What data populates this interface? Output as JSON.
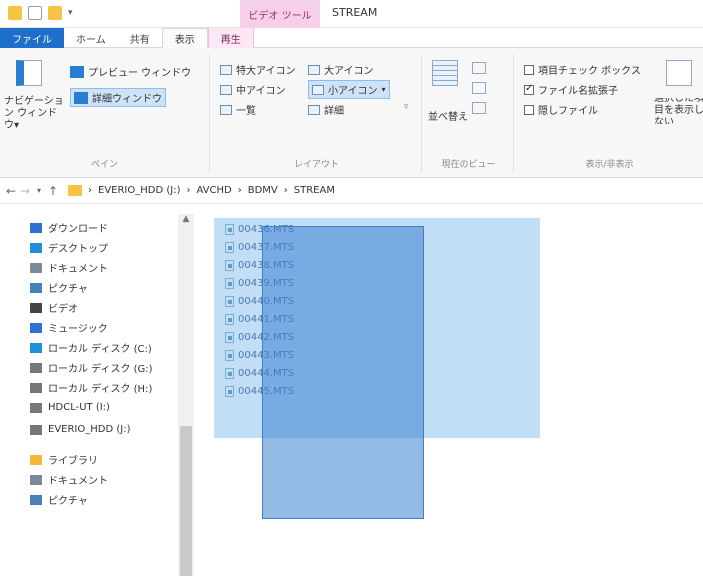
{
  "title_bar": {
    "context_tab_label": "ビデオ ツール",
    "window_title": "STREAM"
  },
  "tabs": [
    {
      "label": "ファイル"
    },
    {
      "label": "ホーム"
    },
    {
      "label": "共有"
    },
    {
      "label": "表示"
    },
    {
      "label": "再生"
    }
  ],
  "ribbon": {
    "pane": {
      "nav_pane_label": "ナビゲーション ウィンドウ▾",
      "preview_pane": "プレビュー ウィンドウ",
      "details_pane": "詳細ウィンドウ",
      "group_label": "ペイン"
    },
    "layout": {
      "extra_large": "特大アイコン",
      "large": "大アイコン",
      "medium": "中アイコン",
      "small": "小アイコン",
      "list": "一覧",
      "details": "詳細",
      "group_label": "レイアウト"
    },
    "current_view": {
      "sort_by": "並べ替え",
      "group_label": "現在のビュー"
    },
    "show_hide": {
      "item_checkboxes": "項目チェック ボックス",
      "item_checkboxes_checked": false,
      "file_extensions": "ファイル名拡張子",
      "file_extensions_checked": true,
      "hidden_items": "隠しファイル",
      "hidden_items_checked": false,
      "hide_selected": "選択した項目を表示しない",
      "group_label": "表示/非表示"
    }
  },
  "address": {
    "crumbs": [
      "EVERIO_HDD (J:)",
      "AVCHD",
      "BDMV",
      "STREAM"
    ]
  },
  "nav_items": [
    {
      "label": "ダウンロード",
      "icon": "download-icon",
      "color": "#2e6fd1"
    },
    {
      "label": "デスクトップ",
      "icon": "desktop-icon",
      "color": "#1e90d8"
    },
    {
      "label": "ドキュメント",
      "icon": "document-icon",
      "color": "#7a8a9a"
    },
    {
      "label": "ピクチャ",
      "icon": "pictures-icon",
      "color": "#4a7fb8"
    },
    {
      "label": "ビデオ",
      "icon": "video-icon",
      "color": "#444444"
    },
    {
      "label": "ミュージック",
      "icon": "music-icon",
      "color": "#2e6fd1"
    },
    {
      "label": "ローカル ディスク (C:)",
      "icon": "local-disk-icon",
      "color": "#1e90d8"
    },
    {
      "label": "ローカル ディスク (G:)",
      "icon": "drive-icon",
      "color": "#777777"
    },
    {
      "label": "ローカル ディスク (H:)",
      "icon": "drive-icon",
      "color": "#777777"
    },
    {
      "label": "HDCL-UT (I:)",
      "icon": "drive-icon",
      "color": "#777777"
    },
    {
      "label": "EVERIO_HDD (J:)",
      "icon": "drive-icon",
      "color": "#777777"
    },
    {
      "label": "ライブラリ",
      "icon": "library-icon",
      "color": "#f2b63a"
    },
    {
      "label": "ドキュメント",
      "icon": "document-icon",
      "color": "#7a8a9a"
    },
    {
      "label": "ピクチャ",
      "icon": "pictures-icon",
      "color": "#4a7fb8"
    }
  ],
  "files": [
    {
      "name": "00436.MTS"
    },
    {
      "name": "00437.MTS"
    },
    {
      "name": "00438.MTS"
    },
    {
      "name": "00439.MTS"
    },
    {
      "name": "00440.MTS"
    },
    {
      "name": "00441.MTS"
    },
    {
      "name": "00442.MTS"
    },
    {
      "name": "00443.MTS"
    },
    {
      "name": "00444.MTS"
    },
    {
      "name": "00445.MTS"
    }
  ]
}
